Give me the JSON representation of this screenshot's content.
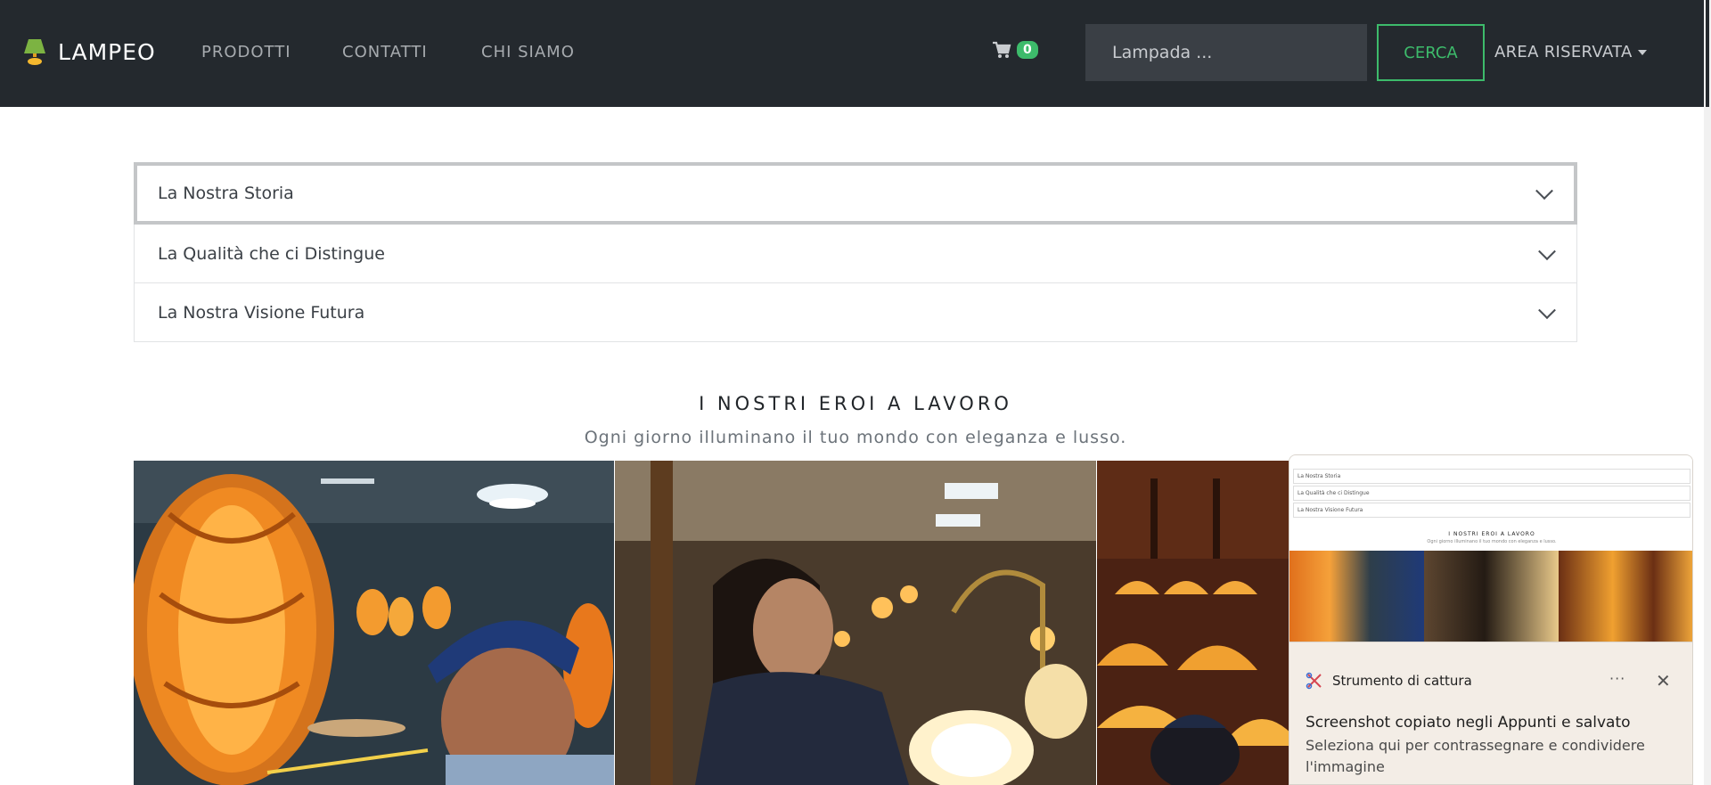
{
  "brand": {
    "name": "LAMPEO"
  },
  "nav": {
    "links": [
      {
        "label": "PRODOTTI"
      },
      {
        "label": "CONTATTI"
      },
      {
        "label": "CHI SIAMO"
      }
    ],
    "cart_count": "0",
    "search_placeholder": "Lampada ...",
    "search_button": "CERCA",
    "account_menu": "AREA RISERVATA"
  },
  "accordion": {
    "items": [
      {
        "title": "La Nostra Storia"
      },
      {
        "title": "La Qualità che ci Distingue"
      },
      {
        "title": "La Nostra Visione Futura"
      }
    ]
  },
  "heroes": {
    "title": "I NOSTRI EROI A LAVORO",
    "subtitle": "Ogni giorno illuminano il tuo mondo con eleganza e lusso."
  },
  "notification": {
    "app_name": "Strumento di cattura",
    "title": "Screenshot copiato negli Appunti e salvato",
    "body": "Seleziona qui per contrassegnare e condividere l'immagine",
    "more_label": "···",
    "close_label": "✕"
  },
  "colors": {
    "navbar_bg": "#24292e",
    "accent_green": "#3dbb6b",
    "lamp_green": "#7cb342",
    "lamp_yellow": "#f5b82e"
  }
}
